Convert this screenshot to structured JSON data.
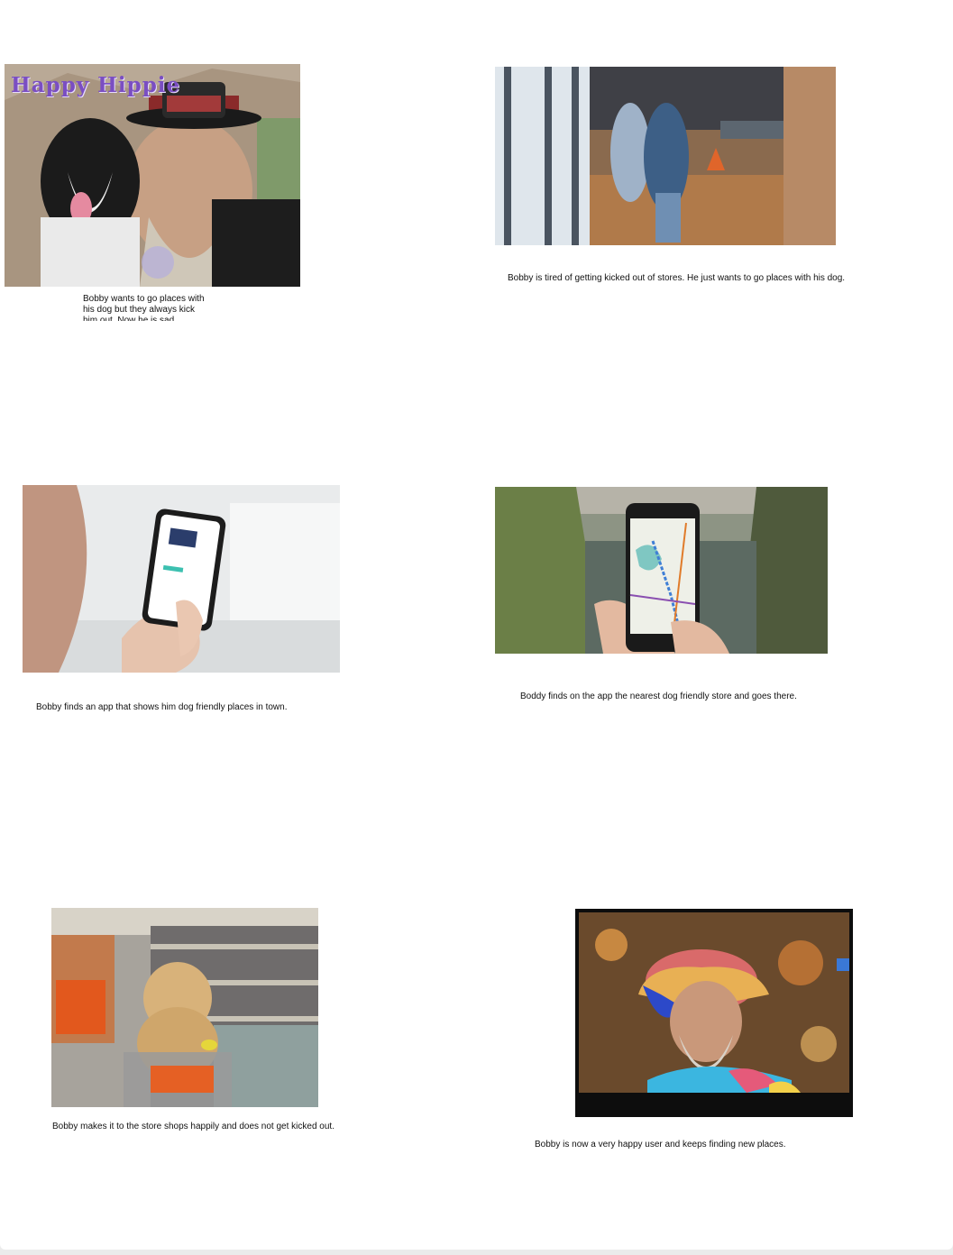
{
  "panels": [
    {
      "caption": "Bobby wants to go places with his dog but they always kick him out. Now he is sad.",
      "image_text": "Happy Hippie"
    },
    {
      "caption": "Bobby is tired of getting kicked out of stores. He just wants to go places with his dog."
    },
    {
      "caption": "Bobby finds an app that shows him dog friendly places in town."
    },
    {
      "caption": "Boddy finds on the app the nearest dog friendly store and goes there."
    },
    {
      "caption": "Bobby makes it to the store shops happily and does not get kicked out."
    },
    {
      "caption": "Bobby is now a very happy user and keeps finding new places."
    }
  ]
}
